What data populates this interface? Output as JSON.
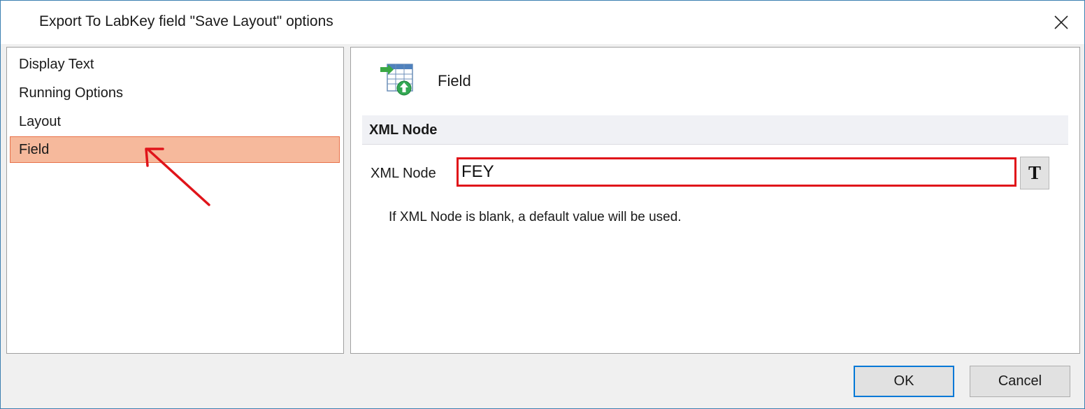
{
  "window": {
    "title": "Export To LabKey field \"Save Layout\" options"
  },
  "nav": {
    "items": [
      {
        "label": "Display Text",
        "selected": false
      },
      {
        "label": "Running Options",
        "selected": false
      },
      {
        "label": "Layout",
        "selected": false
      },
      {
        "label": "Field",
        "selected": true
      }
    ]
  },
  "panel": {
    "title": "Field",
    "section_header": "XML Node",
    "xml_node_label": "XML Node",
    "xml_node_value": "FEY",
    "text_button_label": "T",
    "hint": "If XML Node is blank, a default value will be used."
  },
  "buttons": {
    "ok": "OK",
    "cancel": "Cancel"
  },
  "colors": {
    "selected_bg": "#f6b99c",
    "highlight_red": "#e0141a",
    "accent_blue": "#0078d7"
  }
}
